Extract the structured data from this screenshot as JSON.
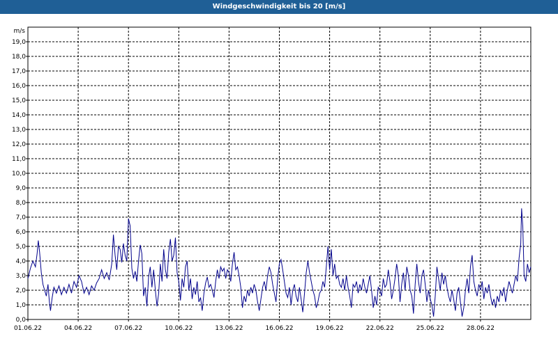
{
  "window": {
    "title": "Windgeschwindigkeit bis 20 [m/s]"
  },
  "chart_data": {
    "type": "line",
    "title": "Windgeschwindigkeit bis 20 [m/s]",
    "ylabel": "m/s",
    "xlabel": "",
    "ylim": [
      0,
      20
    ],
    "xlim": [
      0,
      30
    ],
    "grid": true,
    "line_color": "#00008b",
    "x_tick_labels": [
      "01.06.22",
      "04.06.22",
      "07.06.22",
      "10.06.22",
      "13.06.22",
      "16.06.22",
      "19.06.22",
      "22.06.22",
      "25.06.22",
      "28.06.22"
    ],
    "x_tick_days": [
      0,
      3,
      6,
      9,
      12,
      15,
      18,
      21,
      24,
      27
    ],
    "y_tick_labels": [
      "0,0",
      "1,0",
      "2,0",
      "3,0",
      "4,0",
      "5,0",
      "6,0",
      "7,0",
      "8,0",
      "9,0",
      "10,0",
      "11,0",
      "12,0",
      "13,0",
      "14,0",
      "15,0",
      "16,0",
      "17,0",
      "18,0",
      "19,0"
    ],
    "series": [
      {
        "values": [
          [
            0.0,
            2.8
          ],
          [
            0.15,
            3.5
          ],
          [
            0.3,
            4.0
          ],
          [
            0.45,
            3.6
          ],
          [
            0.55,
            4.5
          ],
          [
            0.62,
            5.4
          ],
          [
            0.7,
            4.6
          ],
          [
            0.8,
            3.2
          ],
          [
            0.9,
            2.4
          ],
          [
            1.0,
            2.0
          ],
          [
            1.1,
            1.6
          ],
          [
            1.2,
            2.4
          ],
          [
            1.28,
            1.2
          ],
          [
            1.35,
            0.6
          ],
          [
            1.45,
            1.5
          ],
          [
            1.55,
            2.2
          ],
          [
            1.7,
            1.8
          ],
          [
            1.85,
            2.3
          ],
          [
            2.0,
            1.7
          ],
          [
            2.15,
            2.2
          ],
          [
            2.3,
            1.8
          ],
          [
            2.45,
            2.4
          ],
          [
            2.6,
            1.8
          ],
          [
            2.75,
            2.6
          ],
          [
            2.9,
            2.2
          ],
          [
            3.05,
            3.0
          ],
          [
            3.2,
            2.6
          ],
          [
            3.35,
            1.8
          ],
          [
            3.5,
            2.2
          ],
          [
            3.65,
            1.7
          ],
          [
            3.8,
            2.3
          ],
          [
            3.95,
            2.0
          ],
          [
            4.1,
            2.5
          ],
          [
            4.25,
            2.8
          ],
          [
            4.4,
            3.4
          ],
          [
            4.55,
            2.8
          ],
          [
            4.7,
            3.2
          ],
          [
            4.85,
            2.7
          ],
          [
            5.0,
            3.8
          ],
          [
            5.1,
            5.8
          ],
          [
            5.2,
            4.4
          ],
          [
            5.3,
            3.4
          ],
          [
            5.4,
            5.0
          ],
          [
            5.5,
            4.8
          ],
          [
            5.6,
            3.9
          ],
          [
            5.7,
            5.2
          ],
          [
            5.8,
            4.4
          ],
          [
            5.9,
            4.0
          ],
          [
            6.0,
            6.9
          ],
          [
            6.1,
            6.4
          ],
          [
            6.2,
            3.5
          ],
          [
            6.3,
            2.8
          ],
          [
            6.4,
            3.3
          ],
          [
            6.5,
            2.6
          ],
          [
            6.6,
            4.0
          ],
          [
            6.7,
            5.1
          ],
          [
            6.8,
            4.5
          ],
          [
            6.9,
            1.6
          ],
          [
            7.0,
            2.2
          ],
          [
            7.1,
            0.9
          ],
          [
            7.2,
            2.9
          ],
          [
            7.3,
            3.6
          ],
          [
            7.4,
            2.2
          ],
          [
            7.5,
            3.4
          ],
          [
            7.6,
            2.0
          ],
          [
            7.7,
            0.9
          ],
          [
            7.8,
            1.8
          ],
          [
            7.9,
            3.8
          ],
          [
            8.0,
            2.6
          ],
          [
            8.1,
            4.8
          ],
          [
            8.2,
            3.4
          ],
          [
            8.3,
            2.8
          ],
          [
            8.4,
            4.6
          ],
          [
            8.5,
            5.5
          ],
          [
            8.6,
            4.0
          ],
          [
            8.7,
            4.4
          ],
          [
            8.8,
            5.6
          ],
          [
            8.9,
            3.2
          ],
          [
            9.0,
            2.6
          ],
          [
            9.1,
            1.3
          ],
          [
            9.2,
            2.8
          ],
          [
            9.3,
            2.2
          ],
          [
            9.4,
            3.6
          ],
          [
            9.5,
            4.0
          ],
          [
            9.6,
            2.0
          ],
          [
            9.7,
            2.8
          ],
          [
            9.8,
            1.4
          ],
          [
            9.9,
            2.2
          ],
          [
            10.0,
            1.7
          ],
          [
            10.1,
            2.6
          ],
          [
            10.2,
            1.2
          ],
          [
            10.3,
            1.5
          ],
          [
            10.4,
            0.6
          ],
          [
            10.5,
            1.8
          ],
          [
            10.6,
            2.5
          ],
          [
            10.7,
            2.9
          ],
          [
            10.8,
            2.2
          ],
          [
            10.9,
            2.4
          ],
          [
            11.0,
            2.0
          ],
          [
            11.1,
            1.5
          ],
          [
            11.2,
            2.6
          ],
          [
            11.3,
            3.4
          ],
          [
            11.4,
            2.8
          ],
          [
            11.5,
            3.6
          ],
          [
            11.6,
            3.3
          ],
          [
            11.7,
            3.5
          ],
          [
            11.8,
            2.8
          ],
          [
            11.9,
            3.4
          ],
          [
            12.0,
            3.2
          ],
          [
            12.1,
            2.6
          ],
          [
            12.2,
            3.8
          ],
          [
            12.3,
            4.6
          ],
          [
            12.4,
            3.4
          ],
          [
            12.5,
            3.6
          ],
          [
            12.6,
            3.0
          ],
          [
            12.7,
            2.2
          ],
          [
            12.8,
            0.8
          ],
          [
            12.9,
            1.6
          ],
          [
            13.0,
            1.2
          ],
          [
            13.1,
            2.0
          ],
          [
            13.2,
            1.6
          ],
          [
            13.3,
            2.2
          ],
          [
            13.4,
            1.8
          ],
          [
            13.5,
            2.4
          ],
          [
            13.6,
            2.0
          ],
          [
            13.7,
            1.2
          ],
          [
            13.8,
            0.6
          ],
          [
            13.9,
            1.4
          ],
          [
            14.0,
            2.2
          ],
          [
            14.1,
            2.6
          ],
          [
            14.2,
            2.0
          ],
          [
            14.3,
            3.0
          ],
          [
            14.4,
            3.6
          ],
          [
            14.5,
            3.2
          ],
          [
            14.6,
            2.4
          ],
          [
            14.7,
            1.8
          ],
          [
            14.8,
            1.2
          ],
          [
            14.9,
            2.8
          ],
          [
            15.0,
            3.8
          ],
          [
            15.1,
            4.1
          ],
          [
            15.2,
            3.4
          ],
          [
            15.3,
            2.6
          ],
          [
            15.4,
            1.8
          ],
          [
            15.5,
            1.5
          ],
          [
            15.6,
            2.2
          ],
          [
            15.7,
            1.0
          ],
          [
            15.8,
            2.0
          ],
          [
            15.9,
            2.4
          ],
          [
            16.0,
            1.6
          ],
          [
            16.1,
            1.2
          ],
          [
            16.2,
            2.2
          ],
          [
            16.3,
            1.4
          ],
          [
            16.4,
            0.5
          ],
          [
            16.5,
            1.8
          ],
          [
            16.6,
            3.2
          ],
          [
            16.7,
            4.0
          ],
          [
            16.8,
            3.2
          ],
          [
            16.9,
            2.6
          ],
          [
            17.0,
            2.0
          ],
          [
            17.1,
            1.6
          ],
          [
            17.2,
            0.8
          ],
          [
            17.3,
            1.2
          ],
          [
            17.4,
            1.8
          ],
          [
            17.5,
            2.0
          ],
          [
            17.6,
            2.6
          ],
          [
            17.7,
            2.2
          ],
          [
            17.8,
            3.6
          ],
          [
            17.9,
            5.0
          ],
          [
            18.0,
            3.4
          ],
          [
            18.1,
            4.8
          ],
          [
            18.2,
            3.0
          ],
          [
            18.3,
            3.8
          ],
          [
            18.4,
            2.8
          ],
          [
            18.5,
            3.0
          ],
          [
            18.6,
            2.4
          ],
          [
            18.7,
            2.2
          ],
          [
            18.8,
            2.8
          ],
          [
            18.9,
            2.0
          ],
          [
            19.0,
            3.0
          ],
          [
            19.1,
            2.2
          ],
          [
            19.2,
            1.6
          ],
          [
            19.3,
            0.8
          ],
          [
            19.4,
            2.4
          ],
          [
            19.5,
            2.2
          ],
          [
            19.6,
            2.6
          ],
          [
            19.7,
            1.8
          ],
          [
            19.8,
            2.4
          ],
          [
            19.9,
            2.0
          ],
          [
            20.0,
            2.8
          ],
          [
            20.1,
            2.2
          ],
          [
            20.2,
            1.8
          ],
          [
            20.3,
            2.4
          ],
          [
            20.4,
            3.0
          ],
          [
            20.5,
            2.0
          ],
          [
            20.6,
            0.8
          ],
          [
            20.7,
            1.6
          ],
          [
            20.8,
            1.0
          ],
          [
            20.9,
            2.2
          ],
          [
            21.0,
            2.0
          ],
          [
            21.1,
            1.6
          ],
          [
            21.2,
            2.8
          ],
          [
            21.3,
            2.2
          ],
          [
            21.4,
            2.4
          ],
          [
            21.5,
            3.4
          ],
          [
            21.6,
            2.6
          ],
          [
            21.7,
            1.4
          ],
          [
            21.8,
            2.0
          ],
          [
            21.9,
            2.8
          ],
          [
            22.0,
            3.8
          ],
          [
            22.1,
            3.0
          ],
          [
            22.2,
            1.2
          ],
          [
            22.3,
            2.4
          ],
          [
            22.4,
            3.2
          ],
          [
            22.5,
            2.0
          ],
          [
            22.6,
            3.6
          ],
          [
            22.7,
            3.0
          ],
          [
            22.8,
            2.0
          ],
          [
            22.9,
            1.6
          ],
          [
            23.0,
            0.4
          ],
          [
            23.1,
            2.4
          ],
          [
            23.2,
            3.8
          ],
          [
            23.3,
            2.6
          ],
          [
            23.4,
            1.8
          ],
          [
            23.5,
            3.0
          ],
          [
            23.6,
            3.4
          ],
          [
            23.7,
            2.4
          ],
          [
            23.8,
            1.2
          ],
          [
            23.9,
            2.0
          ],
          [
            24.0,
            1.4
          ],
          [
            24.1,
            1.0
          ],
          [
            24.2,
            0.2
          ],
          [
            24.3,
            1.6
          ],
          [
            24.4,
            3.6
          ],
          [
            24.5,
            2.8
          ],
          [
            24.6,
            2.0
          ],
          [
            24.7,
            3.2
          ],
          [
            24.8,
            2.4
          ],
          [
            24.9,
            3.0
          ],
          [
            25.0,
            2.2
          ],
          [
            25.1,
            1.6
          ],
          [
            25.2,
            1.2
          ],
          [
            25.3,
            2.0
          ],
          [
            25.4,
            1.4
          ],
          [
            25.5,
            0.6
          ],
          [
            25.6,
            1.8
          ],
          [
            25.7,
            2.2
          ],
          [
            25.8,
            1.2
          ],
          [
            25.9,
            0.2
          ],
          [
            26.0,
            0.8
          ],
          [
            26.1,
            2.0
          ],
          [
            26.2,
            2.8
          ],
          [
            26.3,
            1.8
          ],
          [
            26.4,
            3.6
          ],
          [
            26.5,
            4.4
          ],
          [
            26.6,
            2.6
          ],
          [
            26.7,
            2.0
          ],
          [
            26.8,
            1.6
          ],
          [
            26.9,
            2.4
          ],
          [
            27.0,
            2.0
          ],
          [
            27.1,
            2.6
          ],
          [
            27.2,
            1.4
          ],
          [
            27.3,
            2.2
          ],
          [
            27.4,
            1.8
          ],
          [
            27.5,
            2.4
          ],
          [
            27.6,
            1.6
          ],
          [
            27.7,
            1.0
          ],
          [
            27.8,
            1.4
          ],
          [
            27.9,
            0.8
          ],
          [
            28.0,
            1.6
          ],
          [
            28.1,
            1.2
          ],
          [
            28.2,
            2.0
          ],
          [
            28.3,
            1.6
          ],
          [
            28.4,
            2.2
          ],
          [
            28.5,
            1.2
          ],
          [
            28.6,
            2.0
          ],
          [
            28.7,
            2.6
          ],
          [
            28.8,
            2.2
          ],
          [
            28.9,
            1.8
          ],
          [
            29.0,
            2.4
          ],
          [
            29.1,
            3.0
          ],
          [
            29.2,
            2.6
          ],
          [
            29.3,
            4.2
          ],
          [
            29.4,
            5.2
          ],
          [
            29.45,
            7.6
          ],
          [
            29.52,
            6.4
          ],
          [
            29.6,
            3.0
          ],
          [
            29.7,
            2.6
          ],
          [
            29.8,
            3.8
          ],
          [
            29.9,
            3.2
          ],
          [
            30.0,
            3.6
          ]
        ]
      }
    ]
  }
}
